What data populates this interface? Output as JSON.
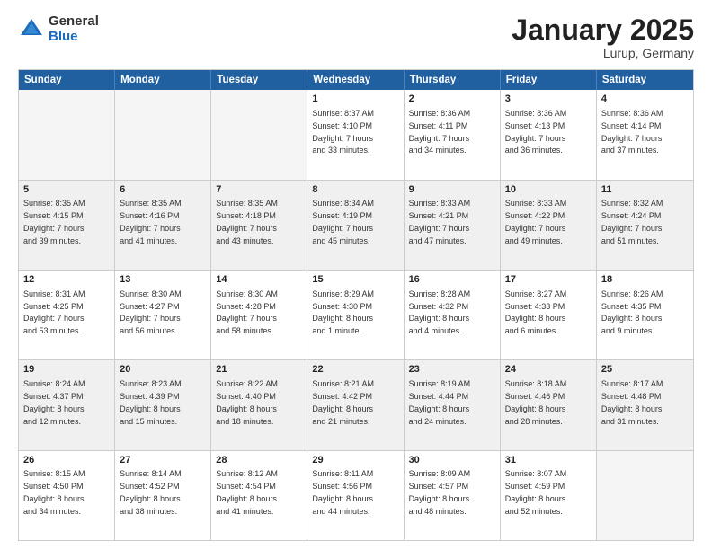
{
  "logo": {
    "general": "General",
    "blue": "Blue"
  },
  "title": {
    "month": "January 2025",
    "location": "Lurup, Germany"
  },
  "header_days": [
    "Sunday",
    "Monday",
    "Tuesday",
    "Wednesday",
    "Thursday",
    "Friday",
    "Saturday"
  ],
  "weeks": [
    [
      {
        "day": "",
        "info": "",
        "empty": true
      },
      {
        "day": "",
        "info": "",
        "empty": true
      },
      {
        "day": "",
        "info": "",
        "empty": true
      },
      {
        "day": "1",
        "info": "Sunrise: 8:37 AM\nSunset: 4:10 PM\nDaylight: 7 hours\nand 33 minutes."
      },
      {
        "day": "2",
        "info": "Sunrise: 8:36 AM\nSunset: 4:11 PM\nDaylight: 7 hours\nand 34 minutes."
      },
      {
        "day": "3",
        "info": "Sunrise: 8:36 AM\nSunset: 4:13 PM\nDaylight: 7 hours\nand 36 minutes."
      },
      {
        "day": "4",
        "info": "Sunrise: 8:36 AM\nSunset: 4:14 PM\nDaylight: 7 hours\nand 37 minutes."
      }
    ],
    [
      {
        "day": "5",
        "info": "Sunrise: 8:35 AM\nSunset: 4:15 PM\nDaylight: 7 hours\nand 39 minutes.",
        "shade": true
      },
      {
        "day": "6",
        "info": "Sunrise: 8:35 AM\nSunset: 4:16 PM\nDaylight: 7 hours\nand 41 minutes.",
        "shade": true
      },
      {
        "day": "7",
        "info": "Sunrise: 8:35 AM\nSunset: 4:18 PM\nDaylight: 7 hours\nand 43 minutes.",
        "shade": true
      },
      {
        "day": "8",
        "info": "Sunrise: 8:34 AM\nSunset: 4:19 PM\nDaylight: 7 hours\nand 45 minutes.",
        "shade": true
      },
      {
        "day": "9",
        "info": "Sunrise: 8:33 AM\nSunset: 4:21 PM\nDaylight: 7 hours\nand 47 minutes.",
        "shade": true
      },
      {
        "day": "10",
        "info": "Sunrise: 8:33 AM\nSunset: 4:22 PM\nDaylight: 7 hours\nand 49 minutes.",
        "shade": true
      },
      {
        "day": "11",
        "info": "Sunrise: 8:32 AM\nSunset: 4:24 PM\nDaylight: 7 hours\nand 51 minutes.",
        "shade": true
      }
    ],
    [
      {
        "day": "12",
        "info": "Sunrise: 8:31 AM\nSunset: 4:25 PM\nDaylight: 7 hours\nand 53 minutes."
      },
      {
        "day": "13",
        "info": "Sunrise: 8:30 AM\nSunset: 4:27 PM\nDaylight: 7 hours\nand 56 minutes."
      },
      {
        "day": "14",
        "info": "Sunrise: 8:30 AM\nSunset: 4:28 PM\nDaylight: 7 hours\nand 58 minutes."
      },
      {
        "day": "15",
        "info": "Sunrise: 8:29 AM\nSunset: 4:30 PM\nDaylight: 8 hours\nand 1 minute."
      },
      {
        "day": "16",
        "info": "Sunrise: 8:28 AM\nSunset: 4:32 PM\nDaylight: 8 hours\nand 4 minutes."
      },
      {
        "day": "17",
        "info": "Sunrise: 8:27 AM\nSunset: 4:33 PM\nDaylight: 8 hours\nand 6 minutes."
      },
      {
        "day": "18",
        "info": "Sunrise: 8:26 AM\nSunset: 4:35 PM\nDaylight: 8 hours\nand 9 minutes."
      }
    ],
    [
      {
        "day": "19",
        "info": "Sunrise: 8:24 AM\nSunset: 4:37 PM\nDaylight: 8 hours\nand 12 minutes.",
        "shade": true
      },
      {
        "day": "20",
        "info": "Sunrise: 8:23 AM\nSunset: 4:39 PM\nDaylight: 8 hours\nand 15 minutes.",
        "shade": true
      },
      {
        "day": "21",
        "info": "Sunrise: 8:22 AM\nSunset: 4:40 PM\nDaylight: 8 hours\nand 18 minutes.",
        "shade": true
      },
      {
        "day": "22",
        "info": "Sunrise: 8:21 AM\nSunset: 4:42 PM\nDaylight: 8 hours\nand 21 minutes.",
        "shade": true
      },
      {
        "day": "23",
        "info": "Sunrise: 8:19 AM\nSunset: 4:44 PM\nDaylight: 8 hours\nand 24 minutes.",
        "shade": true
      },
      {
        "day": "24",
        "info": "Sunrise: 8:18 AM\nSunset: 4:46 PM\nDaylight: 8 hours\nand 28 minutes.",
        "shade": true
      },
      {
        "day": "25",
        "info": "Sunrise: 8:17 AM\nSunset: 4:48 PM\nDaylight: 8 hours\nand 31 minutes.",
        "shade": true
      }
    ],
    [
      {
        "day": "26",
        "info": "Sunrise: 8:15 AM\nSunset: 4:50 PM\nDaylight: 8 hours\nand 34 minutes."
      },
      {
        "day": "27",
        "info": "Sunrise: 8:14 AM\nSunset: 4:52 PM\nDaylight: 8 hours\nand 38 minutes."
      },
      {
        "day": "28",
        "info": "Sunrise: 8:12 AM\nSunset: 4:54 PM\nDaylight: 8 hours\nand 41 minutes."
      },
      {
        "day": "29",
        "info": "Sunrise: 8:11 AM\nSunset: 4:56 PM\nDaylight: 8 hours\nand 44 minutes."
      },
      {
        "day": "30",
        "info": "Sunrise: 8:09 AM\nSunset: 4:57 PM\nDaylight: 8 hours\nand 48 minutes."
      },
      {
        "day": "31",
        "info": "Sunrise: 8:07 AM\nSunset: 4:59 PM\nDaylight: 8 hours\nand 52 minutes."
      },
      {
        "day": "",
        "info": "",
        "empty": true
      }
    ]
  ]
}
